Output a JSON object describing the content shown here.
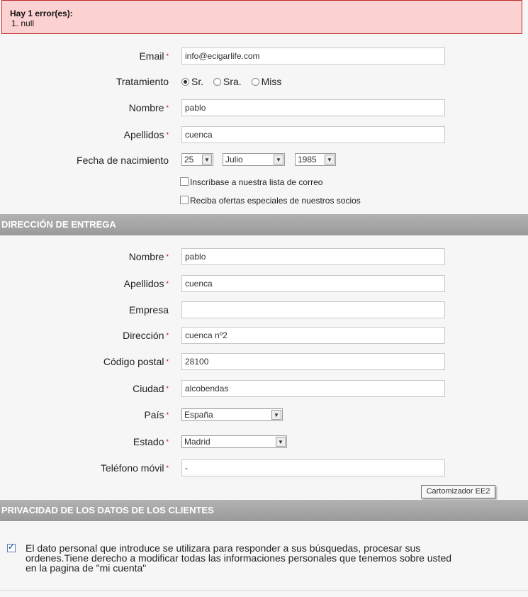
{
  "error": {
    "title": "Hay 1 error(es):",
    "item": "1.  null"
  },
  "personal": {
    "email": {
      "label": "Email",
      "value": "info@ecigarlife.com"
    },
    "treatment": {
      "label": "Tratamiento",
      "options": [
        "Sr.",
        "Sra.",
        "Miss"
      ],
      "selected": "Sr."
    },
    "first_name": {
      "label": "Nombre",
      "value": "pablo"
    },
    "last_name": {
      "label": "Apellidos",
      "value": "cuenca"
    },
    "birth_date": {
      "label": "Fecha de nacimiento",
      "day": "25",
      "month": "Julio",
      "year": "1985"
    },
    "newsletter": {
      "label": "Inscríbase a nuestra lista de correo",
      "checked": false
    },
    "offers": {
      "label": "Reciba ofertas especiales de nuestros socios",
      "checked": false
    }
  },
  "delivery": {
    "section_title": "DIRECCIÓN DE ENTREGA",
    "first_name": {
      "label": "Nombre",
      "value": "pablo"
    },
    "last_name": {
      "label": "Apellidos",
      "value": "cuenca"
    },
    "company": {
      "label": "Empresa",
      "value": ""
    },
    "address": {
      "label": "Dirección",
      "value": "cuenca nº2"
    },
    "postal_code": {
      "label": "Código postal",
      "value": "28100"
    },
    "city": {
      "label": "Ciudad",
      "value": "alcobendas"
    },
    "country": {
      "label": "País",
      "value": "España"
    },
    "state": {
      "label": "Estado",
      "value": "Madrid"
    },
    "mobile": {
      "label": "Teléfono móvil",
      "value": "-"
    }
  },
  "tooltip": "Cartomizador EE2",
  "privacy": {
    "section_title": "PRIVACIDAD DE LOS DATOS DE LOS CLIENTES",
    "checked": true,
    "text": "El dato personal que introduce se utilizara para responder a sus búsquedas, procesar sus ordenes.Tiene derecho a modificar todas las informaciones personales que tenemos sobre usted en la pagina de \"mi cuenta\""
  },
  "required_marker": "*"
}
